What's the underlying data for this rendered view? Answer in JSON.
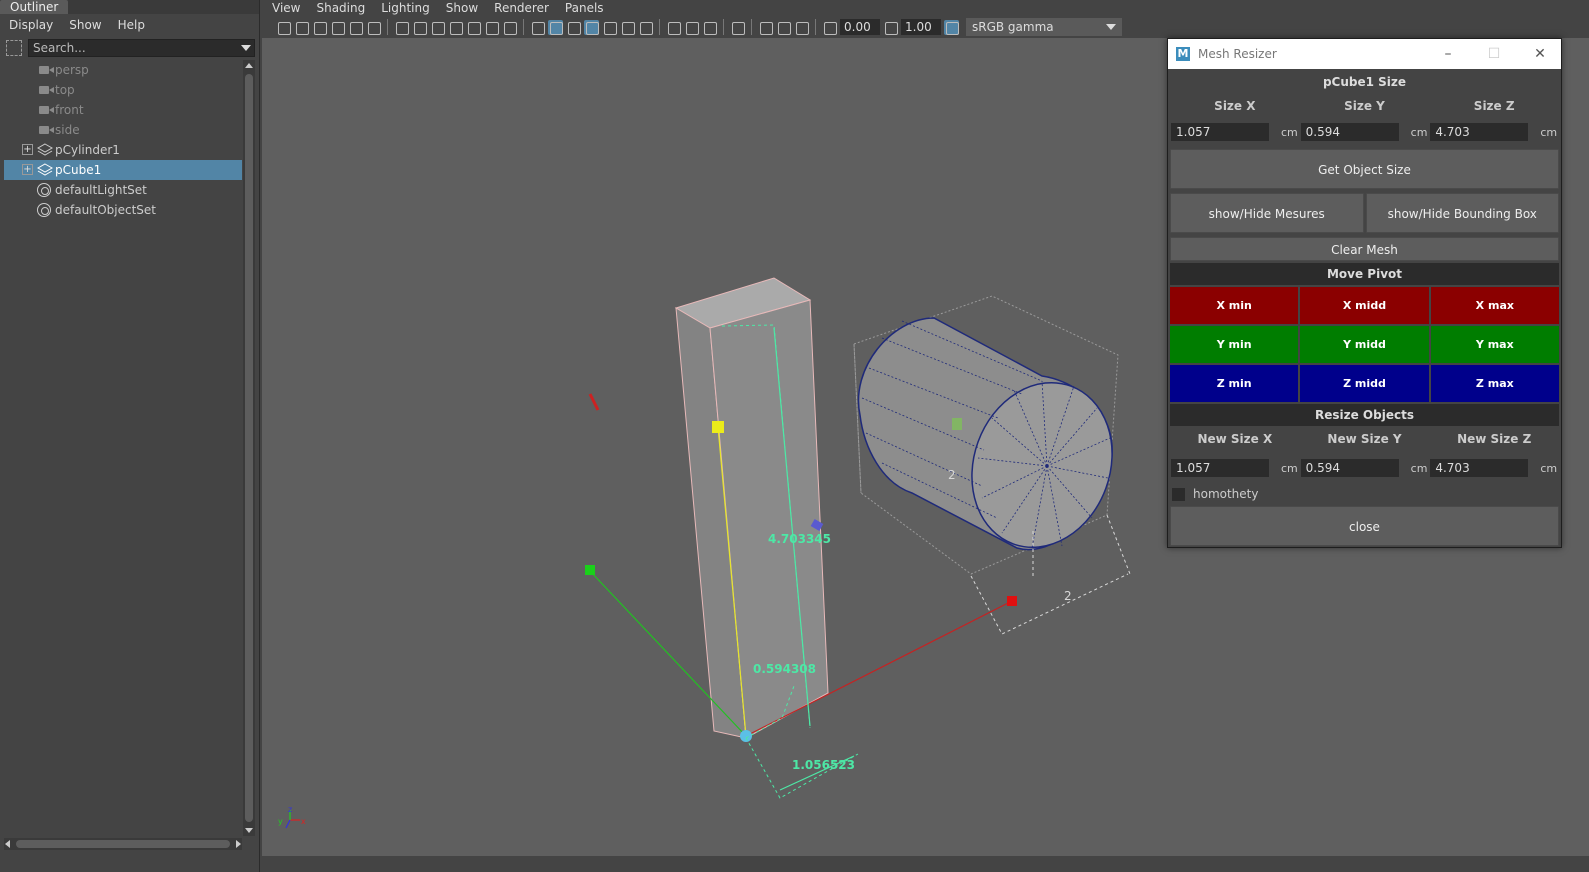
{
  "outliner": {
    "tab_label": "Outliner",
    "menu": [
      "Display",
      "Show",
      "Help"
    ],
    "search_placeholder": "Search...",
    "items": [
      {
        "label": "persp",
        "icon": "camera-icon"
      },
      {
        "label": "top",
        "icon": "camera-icon"
      },
      {
        "label": "front",
        "icon": "camera-icon"
      },
      {
        "label": "side",
        "icon": "camera-icon"
      },
      {
        "label": "pCylinder1",
        "icon": "mesh-icon"
      },
      {
        "label": "pCube1",
        "icon": "mesh-icon"
      },
      {
        "label": "defaultLightSet",
        "icon": "set-icon"
      },
      {
        "label": "defaultObjectSet",
        "icon": "set-icon"
      }
    ]
  },
  "viewport": {
    "menu": [
      "View",
      "Shading",
      "Lighting",
      "Show",
      "Renderer",
      "Panels"
    ],
    "exposure": "0.00",
    "gamma": "1.00",
    "color_space": "sRGB gamma",
    "measures": {
      "height": "4.703345",
      "depth": "0.594308",
      "width": "1.056523",
      "cyl_a": "2",
      "cyl_b": "2"
    },
    "axis": {
      "x": "x",
      "y": "y",
      "z": "z"
    }
  },
  "mesh_resizer": {
    "title": "Mesh Resizer",
    "logo": "M",
    "size_heading": "pCube1 Size",
    "labels": {
      "x": "Size X",
      "y": "Size Y",
      "z": "Size Z"
    },
    "values": {
      "x": "1.057",
      "y": "0.594",
      "z": "4.703"
    },
    "unit": "cm",
    "get_size": "Get Object Size",
    "show_measures": "show/Hide Mesures",
    "show_bbox": "show/Hide Bounding Box",
    "clear_mesh": "Clear Mesh",
    "move_pivot": "Move Pivot",
    "pivot": {
      "x": [
        "X min",
        "X midd",
        "X max"
      ],
      "y": [
        "Y min",
        "Y midd",
        "Y max"
      ],
      "z": [
        "Z min",
        "Z midd",
        "Z max"
      ]
    },
    "resize_heading": "Resize Objects",
    "new_labels": {
      "x": "New Size X",
      "y": "New Size Y",
      "z": "New Size Z"
    },
    "new_values": {
      "x": "1.057",
      "y": "0.594",
      "z": "4.703"
    },
    "homothety": "homothety",
    "close": "close"
  },
  "colors": {
    "selection": "#5285a6",
    "pivot_x": "#8b0000",
    "pivot_y": "#007d00",
    "pivot_z": "#00008b",
    "measure": "#4de8a6"
  }
}
